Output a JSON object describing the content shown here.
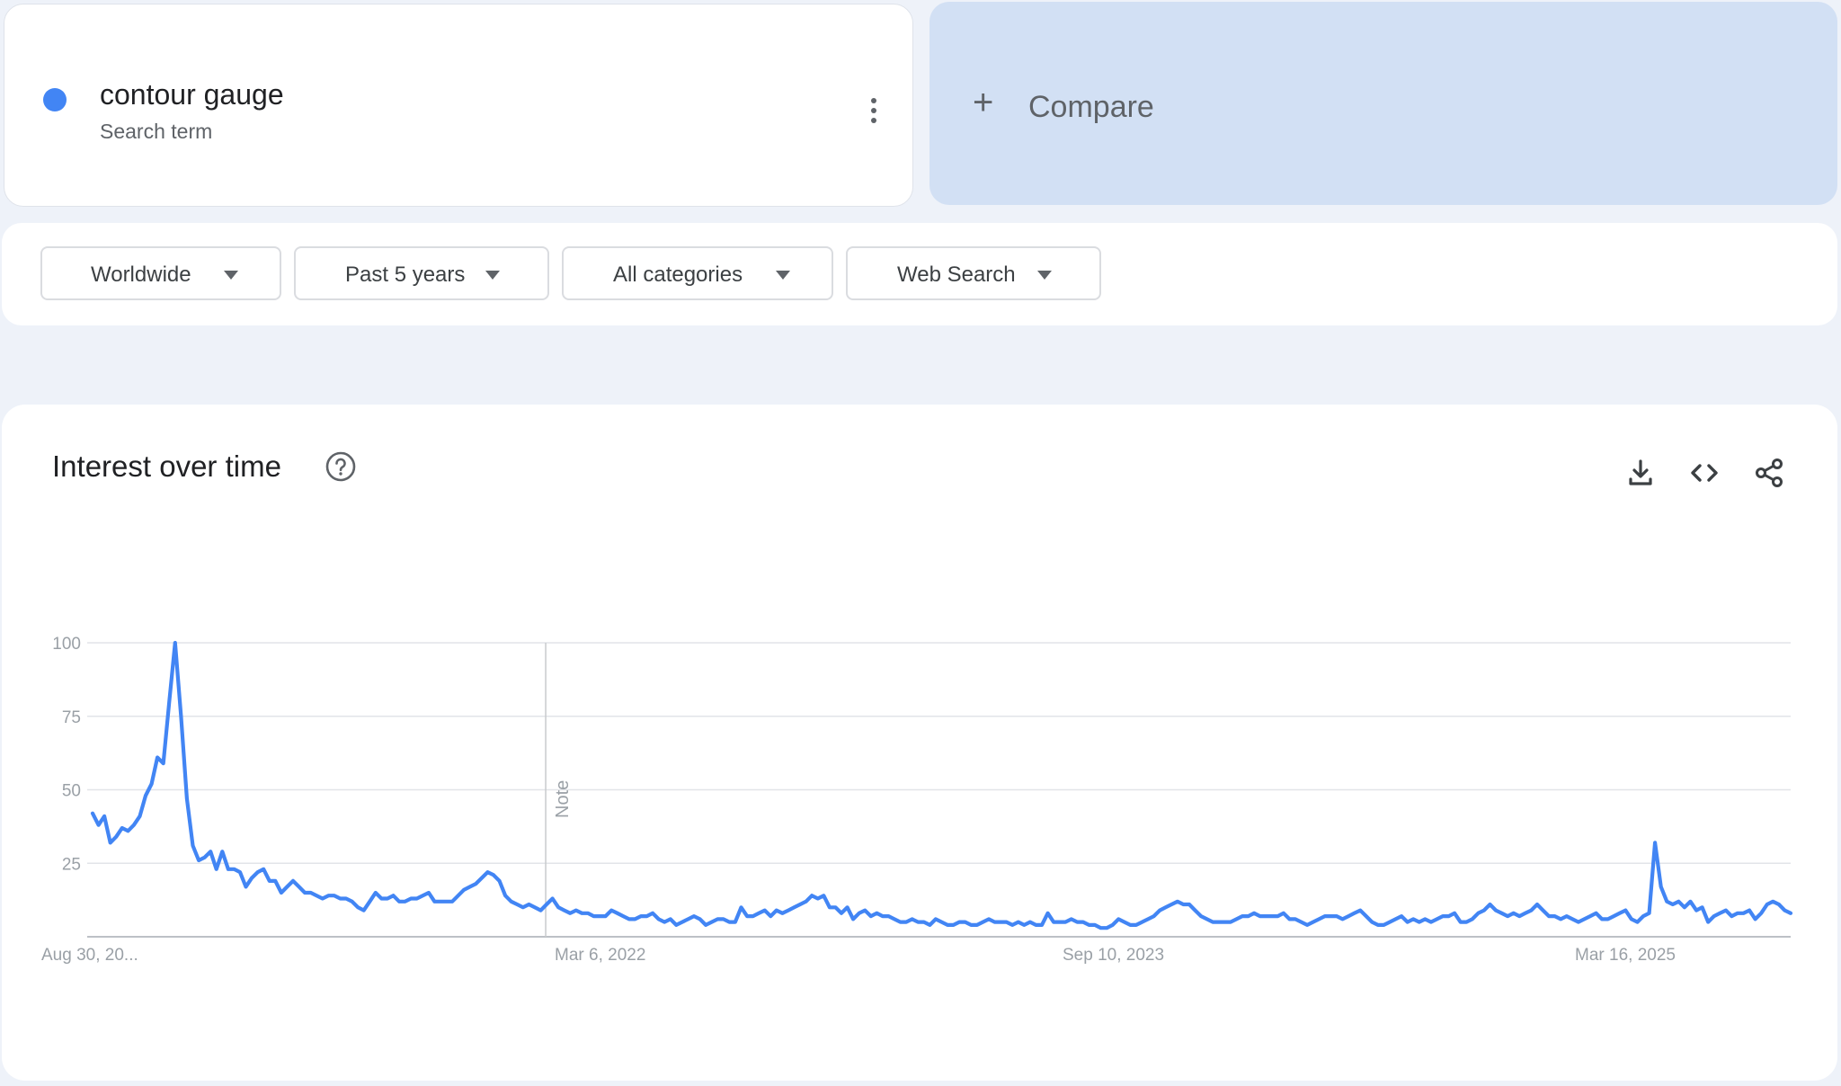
{
  "term": {
    "name": "contour gauge",
    "subtitle": "Search term",
    "color": "#4285f4"
  },
  "compare": {
    "label": "Compare"
  },
  "filters": [
    {
      "label": "Worldwide"
    },
    {
      "label": "Past 5 years"
    },
    {
      "label": "All categories"
    },
    {
      "label": "Web Search"
    }
  ],
  "chart": {
    "title": "Interest over time",
    "note_label": "Note",
    "line_color": "#4285f4"
  },
  "chart_data": {
    "type": "line",
    "title": "Interest over time",
    "xlabel": "",
    "ylabel": "",
    "ylim": [
      0,
      100
    ],
    "yticks": [
      25,
      50,
      75,
      100
    ],
    "xticks": [
      "Aug 30, 20...",
      "Mar 6, 2022",
      "Sep 10, 2023",
      "Mar 16, 2025"
    ],
    "grid": true,
    "annotations": [
      {
        "label": "Note",
        "index": 77
      }
    ],
    "series": [
      {
        "name": "contour gauge",
        "values": [
          42,
          38,
          41,
          32,
          34,
          37,
          36,
          38,
          41,
          48,
          52,
          61,
          59,
          80,
          100,
          75,
          47,
          31,
          26,
          27,
          29,
          23,
          29,
          23,
          23,
          22,
          17,
          20,
          22,
          23,
          19,
          19,
          15,
          17,
          19,
          17,
          15,
          15,
          14,
          13,
          14,
          14,
          13,
          13,
          12,
          10,
          9,
          12,
          15,
          13,
          13,
          14,
          12,
          12,
          13,
          13,
          14,
          15,
          12,
          12,
          12,
          12,
          14,
          16,
          17,
          18,
          20,
          22,
          21,
          19,
          14,
          12,
          11,
          10,
          11,
          10,
          9,
          11,
          13,
          10,
          9,
          8,
          9,
          8,
          8,
          7,
          7,
          7,
          9,
          8,
          7,
          6,
          6,
          7,
          7,
          8,
          6,
          5,
          6,
          4,
          5,
          6,
          7,
          6,
          4,
          5,
          6,
          6,
          5,
          5,
          10,
          7,
          7,
          8,
          9,
          7,
          9,
          8,
          9,
          10,
          11,
          12,
          14,
          13,
          14,
          10,
          10,
          8,
          10,
          6,
          8,
          9,
          7,
          8,
          7,
          7,
          6,
          5,
          5,
          6,
          5,
          5,
          4,
          6,
          5,
          4,
          4,
          5,
          5,
          4,
          4,
          5,
          6,
          5,
          5,
          5,
          4,
          5,
          4,
          5,
          4,
          4,
          8,
          5,
          5,
          5,
          6,
          5,
          5,
          4,
          4,
          3,
          3,
          4,
          6,
          5,
          4,
          4,
          5,
          6,
          7,
          9,
          10,
          11,
          12,
          11,
          11,
          9,
          7,
          6,
          5,
          5,
          5,
          5,
          6,
          7,
          7,
          8,
          7,
          7,
          7,
          7,
          8,
          6,
          6,
          5,
          4,
          5,
          6,
          7,
          7,
          7,
          6,
          7,
          8,
          9,
          7,
          5,
          4,
          4,
          5,
          6,
          7,
          5,
          6,
          5,
          6,
          5,
          6,
          7,
          7,
          8,
          5,
          5,
          6,
          8,
          9,
          11,
          9,
          8,
          7,
          8,
          7,
          8,
          9,
          11,
          9,
          7,
          7,
          6,
          7,
          6,
          5,
          6,
          7,
          8,
          6,
          6,
          7,
          8,
          9,
          6,
          5,
          7,
          8,
          32,
          17,
          12,
          11,
          12,
          10,
          12,
          9,
          10,
          5,
          7,
          8,
          9,
          7,
          8,
          8,
          9,
          6,
          8,
          11,
          12,
          11,
          9,
          8
        ]
      }
    ]
  }
}
